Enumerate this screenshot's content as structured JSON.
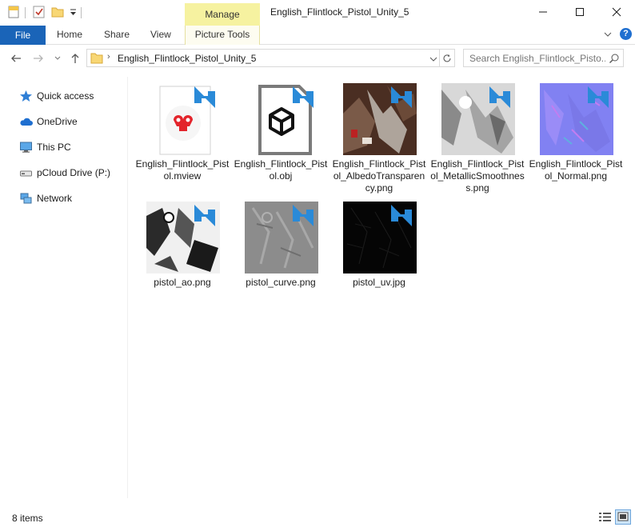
{
  "titlebar": {
    "manage_label": "Manage",
    "window_title": "English_Flintlock_Pistol_Unity_5"
  },
  "ribbon": {
    "tabs": [
      {
        "label": "File"
      },
      {
        "label": "Home"
      },
      {
        "label": "Share"
      },
      {
        "label": "View"
      },
      {
        "label": "Picture Tools"
      }
    ],
    "help_label": "?"
  },
  "address": {
    "path": "English_Flintlock_Pistol_Unity_5",
    "search_placeholder": "Search English_Flintlock_Pisto..."
  },
  "nav_pane": {
    "items": [
      {
        "label": "Quick access",
        "icon": "star-icon"
      },
      {
        "label": "OneDrive",
        "icon": "cloud-icon"
      },
      {
        "label": "This PC",
        "icon": "monitor-icon"
      },
      {
        "label": "pCloud Drive (P:)",
        "icon": "drive-icon"
      },
      {
        "label": "Network",
        "icon": "network-icon"
      }
    ]
  },
  "files": [
    {
      "name": "English_Flintlock_Pistol.mview",
      "icon": "marmoset-icon"
    },
    {
      "name": "English_Flintlock_Pistol.obj",
      "icon": "3d-object-icon"
    },
    {
      "name": "English_Flintlock_Pistol_AlbedoTransparency.png",
      "icon": "image-thumbnail"
    },
    {
      "name": "English_Flintlock_Pistol_MetallicSmoothness.png",
      "icon": "image-thumbnail"
    },
    {
      "name": "English_Flintlock_Pistol_Normal.png",
      "icon": "image-thumbnail"
    },
    {
      "name": "pistol_ao.png",
      "icon": "image-thumbnail"
    },
    {
      "name": "pistol_curve.png",
      "icon": "image-thumbnail"
    },
    {
      "name": "pistol_uv.jpg",
      "icon": "image-thumbnail"
    }
  ],
  "status": {
    "item_count": "8 items"
  },
  "colors": {
    "file_tab": "#1a64b8",
    "manage_tab": "#f6f2a0",
    "sync_arrows": "#2a8ad8",
    "selected_view": "#cce4f7"
  }
}
